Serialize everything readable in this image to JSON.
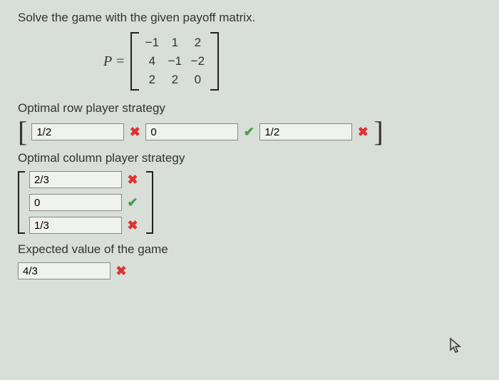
{
  "question_text": "Solve the game with the given payoff matrix.",
  "matrix_label": "P =",
  "matrix": {
    "r1c1": "−1",
    "r1c2": "1",
    "r1c3": "2",
    "r2c1": "4",
    "r2c2": "−1",
    "r2c3": "−2",
    "r3c1": "2",
    "r3c2": "2",
    "r3c3": "0"
  },
  "row_strategy": {
    "label": "Optimal row player strategy",
    "val1": "1/2",
    "val2": "0",
    "val3": "1/2"
  },
  "col_strategy": {
    "label": "Optimal column player strategy",
    "val1": "2/3",
    "val2": "0",
    "val3": "1/3"
  },
  "expected_value": {
    "label": "Expected value of the game",
    "val": "4/3"
  },
  "marks": {
    "wrong": "✖",
    "right": "✔"
  }
}
